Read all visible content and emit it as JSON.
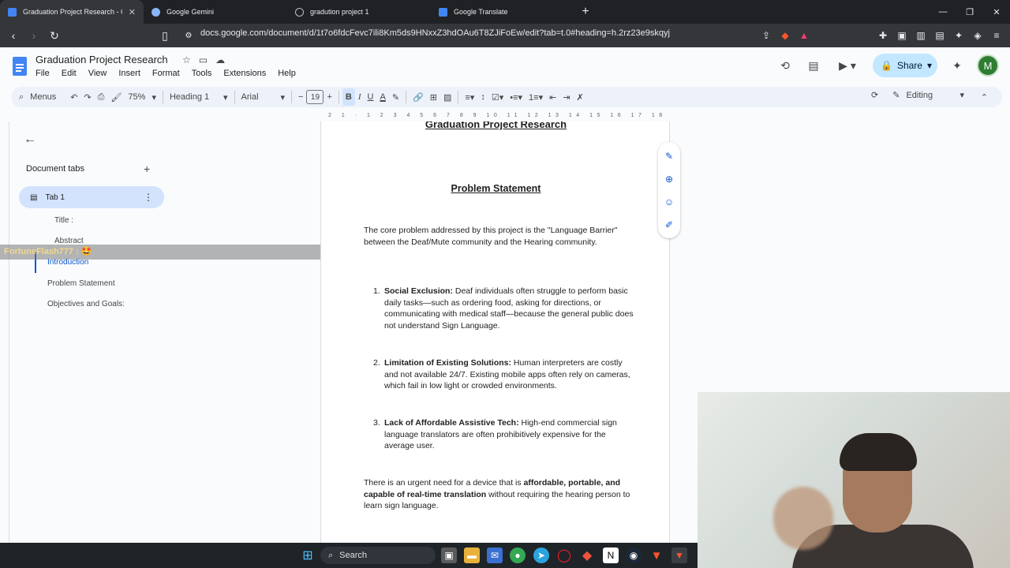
{
  "browser": {
    "tabs": [
      {
        "title": "Graduation Project Research - Goog",
        "active": true,
        "favicon_color": "#4285f4"
      },
      {
        "title": "Google Gemini",
        "active": false,
        "favicon_color": "#8ab4f8"
      },
      {
        "title": "gradution project 1",
        "active": false,
        "favicon_color": "#9aa0a6"
      },
      {
        "title": "Google Translate",
        "active": false,
        "favicon_color": "#4285f4"
      }
    ],
    "new_tab": "+",
    "url": "docs.google.com/document/d/1t7o6fdcFevc7ili8Km5ds9HNxxZ3hdOAu6T8ZJiFoEw/edit?tab=t.0#heading=h.2rz23e9skqyj"
  },
  "docs": {
    "title": "Graduation Project Research",
    "menu": [
      "File",
      "Edit",
      "View",
      "Insert",
      "Format",
      "Tools",
      "Extensions",
      "Help"
    ],
    "share_label": "Share",
    "avatar_letter": "M",
    "toolbar": {
      "menus": "Menus",
      "zoom": "75%",
      "style": "Heading 1",
      "font": "Arial",
      "font_size": "19",
      "mode": "Editing"
    }
  },
  "sidebar": {
    "section_title": "Document tabs",
    "tab_label": "Tab 1",
    "outline": [
      {
        "label": "Title :",
        "level": 2
      },
      {
        "label": "Abstract",
        "level": 2
      },
      {
        "label": "Introduction",
        "level": 1,
        "selected": true
      },
      {
        "label": "Problem Statement",
        "level": 1
      },
      {
        "label": "Objectives and Goals:",
        "level": 1
      }
    ],
    "overlay_text": "FortuneFlash777 : 🤩"
  },
  "ruler": {
    "horizontal": "2 1 · 1 2 3 4 5 6 7 8 9 10 11 12 13 14 15 16 17 18"
  },
  "document": {
    "heading_top": "Graduation Project Research",
    "heading": "Problem Statement",
    "intro": "The core problem addressed by this project is the \"Language Barrier\" between the Deaf/Mute community and the Hearing community.",
    "items": [
      {
        "num": "1.",
        "bold": "Social Exclusion:",
        "text": " Deaf individuals often struggle to perform basic daily tasks—such as ordering food, asking for directions, or communicating with medical staff—because the general public does not understand Sign Language."
      },
      {
        "num": "2.",
        "bold": "Limitation of Existing Solutions:",
        "text": " Human interpreters are costly and not available 24/7. Existing mobile apps often rely on cameras, which fail in low light or crowded environments."
      },
      {
        "num": "3.",
        "bold": "Lack of Affordable Assistive Tech:",
        "text": " High-end commercial sign language translators are often prohibitively expensive for the average user."
      }
    ],
    "closing_pre": "There is an urgent need for a device that is ",
    "closing_bold": "affordable, portable, and capable of real-time translation",
    "closing_post": " without requiring the hearing person to learn sign language."
  },
  "taskbar": {
    "search": "Search"
  }
}
